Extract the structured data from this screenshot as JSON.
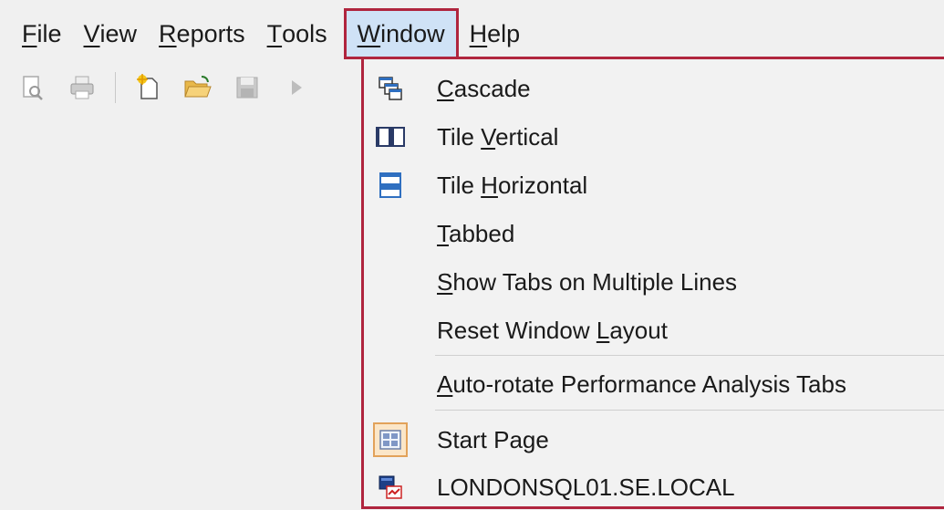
{
  "menubar": {
    "items": [
      {
        "label": "File",
        "accel": "F",
        "rest": "ile"
      },
      {
        "label": "View",
        "accel": "V",
        "rest": "iew"
      },
      {
        "label": "Reports",
        "accel": "R",
        "rest": "eports"
      },
      {
        "label": "Tools",
        "accel": "T",
        "rest": "ools"
      },
      {
        "label": "Window",
        "accel": "W",
        "rest": "indow"
      },
      {
        "label": "Help",
        "accel": "H",
        "rest": "elp"
      }
    ],
    "active": "Window"
  },
  "toolbar": {
    "icons": [
      "print-preview-icon",
      "print-icon",
      "new-document-icon",
      "open-folder-icon",
      "save-icon",
      "play-icon"
    ]
  },
  "window_menu": {
    "items": [
      {
        "pre": "",
        "accel": "C",
        "post": "ascade",
        "icon": "cascade-icon"
      },
      {
        "pre": "Tile ",
        "accel": "V",
        "post": "ertical",
        "icon": "tile-vertical-icon"
      },
      {
        "pre": "Tile ",
        "accel": "H",
        "post": "orizontal",
        "icon": "tile-horizontal-icon"
      },
      {
        "pre": "",
        "accel": "T",
        "post": "abbed",
        "icon": ""
      },
      {
        "pre": "",
        "accel": "S",
        "post": "how Tabs on Multiple Lines",
        "icon": ""
      },
      {
        "pre": "Reset Window ",
        "accel": "L",
        "post": "ayout",
        "icon": ""
      },
      {
        "pre": "",
        "accel": "A",
        "post": "uto-rotate Performance Analysis Tabs",
        "icon": ""
      },
      {
        "pre": "",
        "accel": "",
        "post": "Start Page",
        "icon": "start-page-icon"
      },
      {
        "pre": "",
        "accel": "",
        "post": "LONDONSQL01.SE.LOCAL",
        "icon": "server-icon"
      }
    ]
  },
  "colors": {
    "highlight_border": "#b0253e",
    "menu_bg": "#f2f2f2",
    "active_bg": "#cfe2f6"
  }
}
